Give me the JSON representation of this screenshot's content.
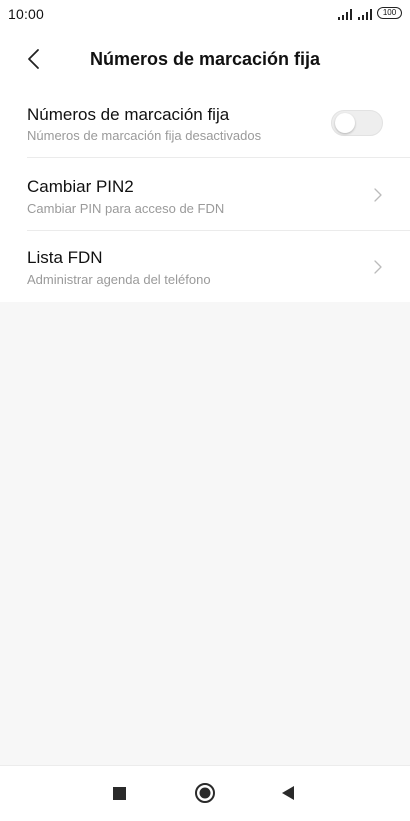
{
  "status_bar": {
    "time": "10:00",
    "signal_1_label": "",
    "signal_2_label": "",
    "battery": "100",
    "signal_icon": "signal-bars-icon"
  },
  "header": {
    "title": "Números de marcación fija",
    "back_icon": "chevron-left-icon"
  },
  "settings": [
    {
      "title": "Números de marcación fija",
      "subtitle": "Números de marcación fija desactivados",
      "control": "toggle",
      "enabled": false
    },
    {
      "title": "Cambiar PIN2",
      "subtitle": "Cambiar PIN para acceso de FDN",
      "control": "chevron"
    },
    {
      "title": "Lista FDN",
      "subtitle": "Administrar agenda del teléfono",
      "control": "chevron"
    }
  ],
  "nav_bar": {
    "recent_icon": "square-icon",
    "home_icon": "circle-icon",
    "back_icon": "triangle-back-icon"
  },
  "colors": {
    "list_background": "#ffffff",
    "page_background": "#f7f7f7",
    "subtitle_text": "#9a9a9a",
    "toggle_off": "#eeeeee"
  }
}
